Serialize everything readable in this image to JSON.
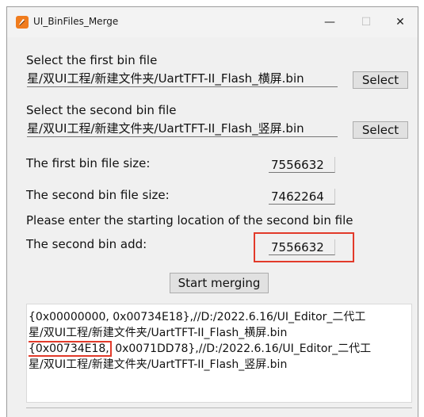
{
  "window": {
    "title": "UI_BinFiles_Merge",
    "controls": {
      "minimize": "—",
      "maximize": "☐",
      "close": "✕"
    }
  },
  "first_file": {
    "label": "Select the first bin file",
    "path": "星/双UI工程/新建文件夹/UartTFT-II_Flash_横屏.bin",
    "button": "Select"
  },
  "second_file": {
    "label": "Select the second bin file",
    "path": "星/双UI工程/新建文件夹/UartTFT-II_Flash_竖屏.bin",
    "button": "Select"
  },
  "first_size": {
    "label": "The first bin file size:",
    "value": "7556632"
  },
  "second_size": {
    "label": "The second bin file size:",
    "value": "7462264"
  },
  "instruction": "Please enter the starting location of the second bin file",
  "second_add": {
    "label": "The second bin add:",
    "value": "7556632"
  },
  "merge_button": "Start merging",
  "output": {
    "line1": "{0x00000000, 0x00734E18},//D:/2022.6.16/UI_Editor_二代工",
    "line2": "星/双UI工程/新建文件夹/UartTFT-II_Flash_横屏.bin",
    "line3_highlight": "{0x00734E18,",
    "line3_rest": " 0x0071DD78},//D:/2022.6.16/UI_Editor_二代工",
    "line4": "星/双UI工程/新建文件夹/UartTFT-II_Flash_竖屏.bin"
  },
  "colors": {
    "highlight": "#e23a2a",
    "app_icon": "#f07c1e"
  }
}
